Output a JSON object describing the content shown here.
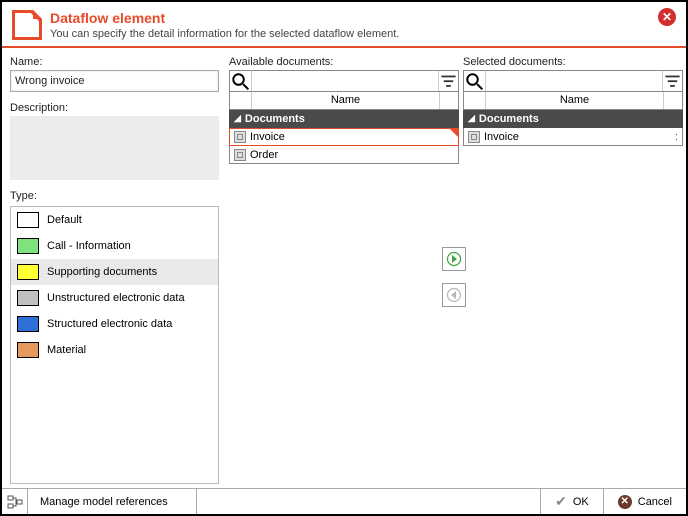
{
  "header": {
    "title": "Dataflow element",
    "subtitle": "You can specify the detail information for the selected dataflow element."
  },
  "left": {
    "name_label": "Name:",
    "name_value": "Wrong invoice",
    "description_label": "Description:",
    "type_label": "Type:"
  },
  "types": [
    {
      "label": "Default",
      "color": "#ffffff",
      "selected": false
    },
    {
      "label": "Call - Information",
      "color": "#7fe27f",
      "selected": false
    },
    {
      "label": "Supporting documents",
      "color": "#ffff33",
      "selected": true
    },
    {
      "label": "Unstructured electronic data",
      "color": "#bfbfbf",
      "selected": false
    },
    {
      "label": "Structured electronic data",
      "color": "#2e6fd9",
      "selected": false
    },
    {
      "label": "Material",
      "color": "#e6995c",
      "selected": false
    }
  ],
  "available": {
    "label": "Available documents:",
    "name_col": "Name",
    "group": "Documents",
    "items": [
      {
        "label": "Invoice",
        "selected": true
      },
      {
        "label": "Order",
        "selected": false
      }
    ]
  },
  "selected": {
    "label": "Selected documents:",
    "name_col": "Name",
    "group": "Documents",
    "items": [
      {
        "label": "Invoice"
      }
    ]
  },
  "footer": {
    "manage": "Manage model references",
    "ok": "OK",
    "cancel": "Cancel"
  }
}
